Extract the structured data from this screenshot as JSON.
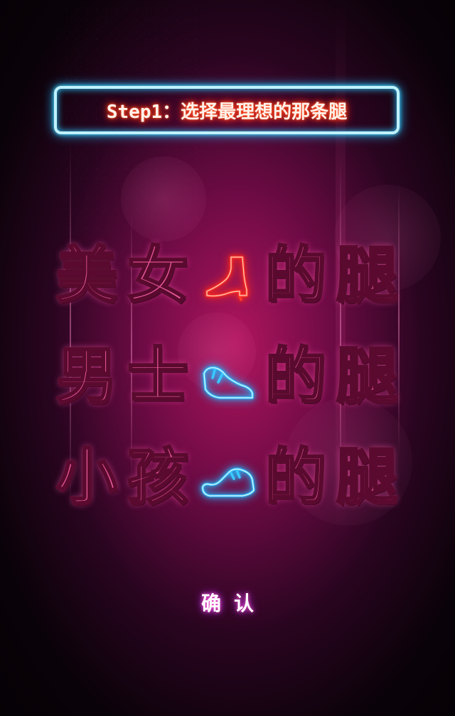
{
  "step_banner": {
    "text": "Step1：选择最理想的那条腿"
  },
  "options": [
    {
      "char1": "美",
      "char2": "女",
      "char3": "的",
      "char4": "腿",
      "icon": "high-heel-boot-icon",
      "icon_color": "#ff3a2a"
    },
    {
      "char1": "男",
      "char2": "士",
      "char3": "的",
      "char4": "腿",
      "icon": "sneaker-icon",
      "icon_color": "#3ac8ff"
    },
    {
      "char1": "小",
      "char2": "孩",
      "char3": "的",
      "char4": "腿",
      "icon": "kids-shoe-icon",
      "icon_color": "#3ac8ff"
    }
  ],
  "confirm": {
    "label": "确认"
  },
  "colors": {
    "background": "#6e0b45",
    "banner_border": "#3ac8ff",
    "banner_text_glow": "#ff3a1a",
    "marquee_fill": "#e85a9a"
  }
}
